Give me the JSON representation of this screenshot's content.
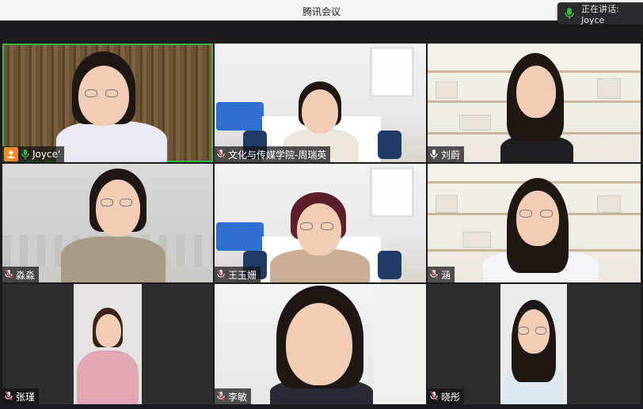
{
  "window": {
    "title": "腾讯会议"
  },
  "speaking_indicator": {
    "label": "正在讲话: Joyce"
  },
  "colors": {
    "active_speaker": "#3bb44a",
    "host_badge": "#f08a24",
    "mic_on": "#3bb44a",
    "mic_muted": "#d24a4a"
  },
  "participants": [
    {
      "name": "Joyce'",
      "mic": "on",
      "host": true,
      "active": true,
      "icon": "mic-icon"
    },
    {
      "name": "文化与传媒学院-周瑞英",
      "mic": "muted",
      "host": false,
      "active": false,
      "icon": "mic-muted-icon"
    },
    {
      "name": "刘蔚",
      "mic": "on",
      "host": false,
      "active": false,
      "icon": "mic-icon"
    },
    {
      "name": "淼淼",
      "mic": "muted",
      "host": false,
      "active": false,
      "icon": "mic-muted-icon"
    },
    {
      "name": "王玉姗",
      "mic": "muted",
      "host": false,
      "active": false,
      "icon": "mic-muted-icon"
    },
    {
      "name": "涵",
      "mic": "muted",
      "host": false,
      "active": false,
      "icon": "mic-muted-icon"
    },
    {
      "name": "张瑾",
      "mic": "muted",
      "host": false,
      "active": false,
      "icon": "mic-muted-icon"
    },
    {
      "name": "李敏",
      "mic": "muted",
      "host": false,
      "active": false,
      "icon": "mic-muted-icon"
    },
    {
      "name": "晓彤",
      "mic": "muted",
      "host": false,
      "active": false,
      "icon": "mic-muted-icon"
    }
  ]
}
